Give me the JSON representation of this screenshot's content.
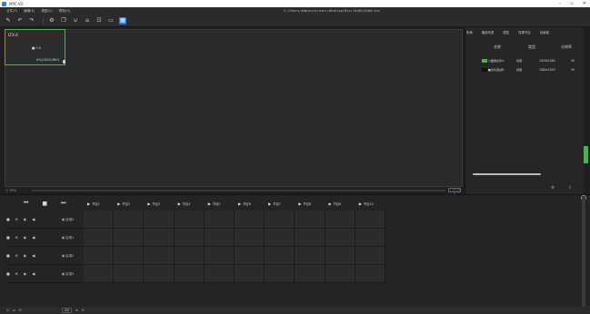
{
  "window": {
    "title": "MPC-VO",
    "minimize": "–",
    "maximize": "▫",
    "close": "✕"
  },
  "menu": {
    "items": [
      "文件(F)",
      "编辑(E)",
      "视图(V)",
      "帮助(H)"
    ],
    "file_path": "C:/Users/Administrator/Desktop/Bixr/0100/0100.bvx"
  },
  "toolbar": {
    "icons": [
      "pencil-icon",
      "undo-icon",
      "redo-icon",
      "gear-icon",
      "copy-icon",
      "magnet-icon",
      "lock-icon",
      "grid-icon",
      "monitor-icon",
      "layout-icon"
    ]
  },
  "canvas": {
    "layer": {
      "title": "LTX.0",
      "line2": "■ 0.0",
      "line3": "0%(1000,960)"
    },
    "zoom_label": "□ 90%",
    "zoom_ctrl": "− □ ▢ +"
  },
  "right_panel": {
    "tabs": [
      "布局",
      "播放列表",
      "属性",
      "效果节目",
      "动画窗"
    ],
    "headers": [
      "名称",
      "类型",
      "分辨率"
    ],
    "rows": [
      {
        "name": "□图像投影A",
        "type": "视频",
        "res": "1920x1080",
        "extra": "30"
      },
      {
        "name": "■光标弧边B",
        "type": "视频",
        "res": "1080x1920",
        "extra": "30"
      }
    ],
    "buttons": [
      "⚙",
      "⇧"
    ]
  },
  "timeline": {
    "controls": [
      "⏮",
      "■",
      "⏭"
    ],
    "programs": [
      "节目1",
      "节目2",
      "节目3",
      "节目4",
      "节目5",
      "节目6",
      "节目7",
      "节目8",
      "节目9",
      "节目10"
    ],
    "tracks": [
      {
        "name": "▦ 区域0"
      },
      {
        "name": "▦ 区域1"
      },
      {
        "name": "▦ 区域2"
      },
      {
        "name": "▦ 区域3"
      }
    ],
    "track_icons": [
      "■",
      "⊖",
      "◉",
      "◀)"
    ],
    "bottom": {
      "icons": [
        "⊡",
        "⇄",
        "⊟"
      ],
      "zoom": "0/0",
      "icons2": [
        "⊕",
        "⊟"
      ]
    }
  },
  "colors": {
    "accent": "#3dbb4a",
    "active": "#2b7de9",
    "bg": "#1f1f21"
  }
}
